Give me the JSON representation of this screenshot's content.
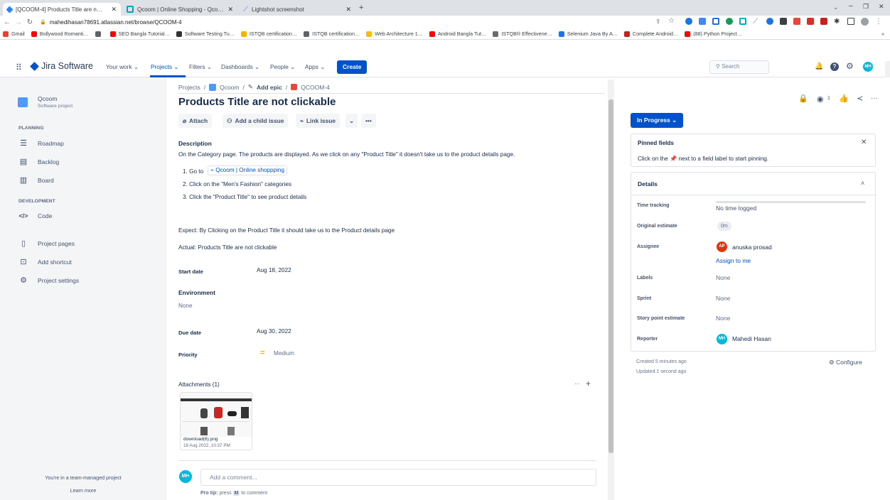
{
  "browser": {
    "tabs": [
      {
        "title": "[QCOOM-4] Products Title are n…",
        "active": true,
        "color": "#2684ff"
      },
      {
        "title": "Qcoom | Online Shopping - Qco…",
        "active": false,
        "color": "#00a3bf"
      },
      {
        "title": "Lightshot screenshot",
        "active": false,
        "color": "#7b61ff"
      }
    ],
    "new_tab": "+",
    "url": "mahedihasan78691.atlassian.net/browse/QCOOM-4",
    "bookmarks": [
      {
        "label": "Gmail",
        "color": "#ea4335"
      },
      {
        "label": "Bollywood Romanti…",
        "color": "#ff0000"
      },
      {
        "label": "",
        "color": "#5f6368"
      },
      {
        "label": "SEO Bangla Tutorial…",
        "color": "#ff0000"
      },
      {
        "label": "Software Testing Tu…",
        "color": "#333333"
      },
      {
        "label": "ISTQB certification…",
        "color": "#f4b400"
      },
      {
        "label": "ISTQB certification…",
        "color": "#5f6368"
      },
      {
        "label": "Web Architecture 1…",
        "color": "#fbbc04"
      },
      {
        "label": "Android Bangla Tut…",
        "color": "#ff0000"
      },
      {
        "label": "ISTQB® Effectivene…",
        "color": "#6c6c6c"
      },
      {
        "label": "Selenium Java By A…",
        "color": "#1a73e8"
      },
      {
        "label": "Complete Android…",
        "color": "#c5221f"
      },
      {
        "label": "(88) Python Project…",
        "color": "#ff0000"
      }
    ],
    "bookmarks_more": "»"
  },
  "nav": {
    "product": "Jira Software",
    "your_work": "Your work",
    "projects": "Projects",
    "filters": "Filters",
    "dashboards": "Dashboards",
    "people": "People",
    "apps": "Apps",
    "create": "Create",
    "search_placeholder": "Search",
    "avatar": "MH"
  },
  "sidebar": {
    "project_name": "Qcoom",
    "project_type": "Software project",
    "planning": "PLANNING",
    "items_planning": [
      "Roadmap",
      "Backlog",
      "Board"
    ],
    "development": "DEVELOPMENT",
    "items_dev": [
      "Code"
    ],
    "items_other": [
      "Project pages",
      "Add shortcut",
      "Project settings"
    ],
    "footer": "You're in a team-managed project",
    "learn_more": "Learn more"
  },
  "breadcrumb": {
    "projects": "Projects",
    "project": "Qcoom",
    "epic": "Add epic",
    "issue": "QCOOM-4",
    "sep": "/"
  },
  "issue": {
    "title": "Products Title are not clickable",
    "actions": {
      "attach": "Attach",
      "child": "Add a child issue",
      "link": "Link issue",
      "more": "•••"
    },
    "description_label": "Description",
    "description": "On the Category page. The products are displayed. As we click on any \"Product Title\" it doesn't take us to the product details page.",
    "steps": [
      "1. Go to",
      "2. Click on the \"Men's Fashion\" categories",
      "3. Click the \"Product Title\" to see product details"
    ],
    "step_link": "Qcoom | Online shoppping",
    "expect": "Expect: By Clicking on the Product Title it should take us to the Product details page",
    "actual": "Actual: Products Title are not clickable",
    "start_label": "Start date",
    "start_value": "Aug 18, 2022",
    "env_label": "Environment",
    "env_value": "None",
    "due_label": "Due date",
    "due_value": "Aug 30, 2022",
    "priority_label": "Priority",
    "priority_value": "Medium",
    "attachments_label": "Attachments (1)",
    "attachment_name": "download(6).png",
    "attachment_date": "18 Aug 2022, 10:37 PM",
    "comment_avatar": "MH",
    "comment_placeholder": "Add a comment...",
    "pro_tip": "Pro tip:",
    "pro_tip_rest": "press",
    "pro_tip_key": "M",
    "pro_tip_end": "to comment"
  },
  "panel": {
    "watchers": "1",
    "status": "In Progress",
    "pinned_title": "Pinned fields",
    "pinned_text_pre": "Click on the",
    "pinned_text_post": "next to a field label to start pinning.",
    "details_title": "Details",
    "time_tracking_label": "Time tracking",
    "time_tracking_value": "No time logged",
    "original_estimate_label": "Original estimate",
    "original_estimate_value": "0m",
    "assignee_label": "Assignee",
    "assignee_value": "anuska prosad",
    "assignee_avatar": "AP",
    "assign_to_me": "Assign to me",
    "labels_label": "Labels",
    "labels_value": "None",
    "sprint_label": "Sprint",
    "sprint_value": "None",
    "story_label": "Story point estimate",
    "story_value": "None",
    "reporter_label": "Reporter",
    "reporter_value": "Mahedi Hasan",
    "reporter_avatar": "MH",
    "created": "Created 5 minutes ago",
    "updated": "Updated 1 second ago",
    "configure": "Configure"
  }
}
